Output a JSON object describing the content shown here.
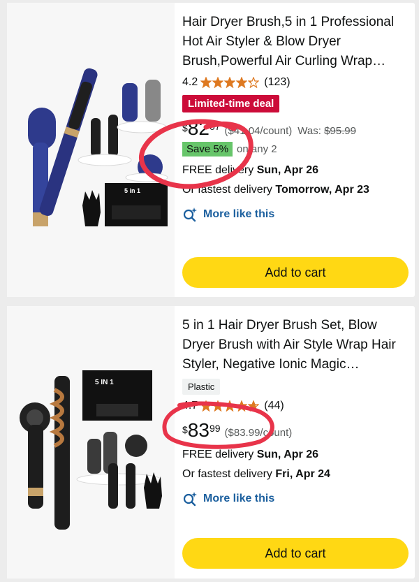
{
  "products": [
    {
      "title": "Hair Dryer Brush,5 in 1 Professional Hot Air Styler & Blow Dryer Brush,Powerful Air Curling Wrap…",
      "rating": "4.2",
      "rating_stars": 4.2,
      "review_count": "(123)",
      "deal_badge": "Limited-time deal",
      "price_currency": "$",
      "price_whole": "82",
      "price_fraction": "07",
      "unit_price": "($41.04/count)",
      "was_label": "Was:",
      "was_price": "$95.99",
      "save_badge": "Save 5%",
      "save_note": "on any 2",
      "delivery_label": "FREE delivery",
      "delivery_date": "Sun, Apr 26",
      "fastest_label": "Or fastest delivery",
      "fastest_date": "Tomorrow, Apr 23",
      "more_like_this": "More like this",
      "add_to_cart": "Add to cart",
      "image_label": "5 in 1"
    },
    {
      "title": "5 in 1 Hair Dryer Brush Set, Blow Dryer Brush with Air Style Wrap Hair Styler, Negative Ionic Magic…",
      "material": "Plastic",
      "rating": "4.7",
      "rating_stars": 4.7,
      "review_count": "(44)",
      "price_currency": "$",
      "price_whole": "83",
      "price_fraction": "99",
      "unit_price": "($83.99/count)",
      "delivery_label": "FREE delivery",
      "delivery_date": "Sun, Apr 26",
      "fastest_label": "Or fastest delivery",
      "fastest_date": "Fri, Apr 24",
      "more_like_this": "More like this",
      "add_to_cart": "Add to cart",
      "image_label": "5 IN 1"
    }
  ],
  "colors": {
    "star": "#de7921",
    "deal": "#cc0c39",
    "save": "#67c56a",
    "link": "#1b5f9e",
    "cart": "#ffd814",
    "annotation": "#e8344a"
  },
  "icons": [
    "star-icon",
    "sparkle-search-icon"
  ]
}
